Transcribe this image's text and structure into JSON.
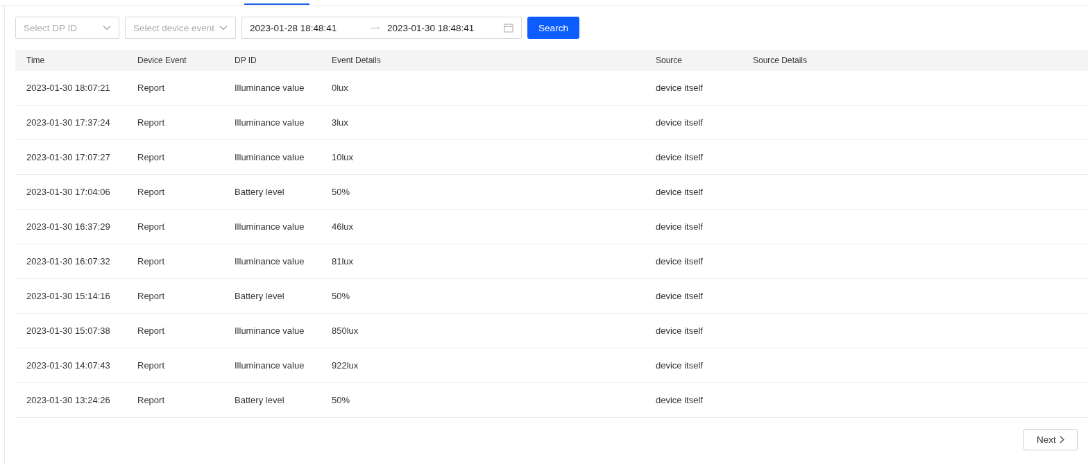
{
  "filters": {
    "dp_select": {
      "placeholder": "Select DP ID"
    },
    "event_select": {
      "placeholder": "Select device event"
    },
    "date_range": {
      "start": "2023-01-28 18:48:41",
      "end": "2023-01-30 18:48:41"
    },
    "search_button": "Search"
  },
  "table": {
    "columns": [
      "Time",
      "Device Event",
      "DP ID",
      "Event Details",
      "Source",
      "Source Details"
    ],
    "rows": [
      [
        "2023-01-30 18:07:21",
        "Report",
        "Illuminance value",
        "0lux",
        "device itself"
      ],
      [
        "2023-01-30 17:37:24",
        "Report",
        "Illuminance value",
        "3lux",
        "device itself"
      ],
      [
        "2023-01-30 17:07:27",
        "Report",
        "Illuminance value",
        "10lux",
        "device itself"
      ],
      [
        "2023-01-30 17:04:06",
        "Report",
        "Battery level",
        "50%",
        "device itself"
      ],
      [
        "2023-01-30 16:37:29",
        "Report",
        "Illuminance value",
        "46lux",
        "device itself"
      ],
      [
        "2023-01-30 16:07:32",
        "Report",
        "Illuminance value",
        "81lux",
        "device itself"
      ],
      [
        "2023-01-30 15:14:16",
        "Report",
        "Battery level",
        "50%",
        "device itself"
      ],
      [
        "2023-01-30 15:07:38",
        "Report",
        "Illuminance value",
        "850lux",
        "device itself"
      ],
      [
        "2023-01-30 14:07:43",
        "Report",
        "Illuminance value",
        "922lux",
        "device itself"
      ],
      [
        "2023-01-30 13:24:26",
        "Report",
        "Battery level",
        "50%",
        "device itself"
      ]
    ]
  },
  "pagination": {
    "next": "Next"
  }
}
